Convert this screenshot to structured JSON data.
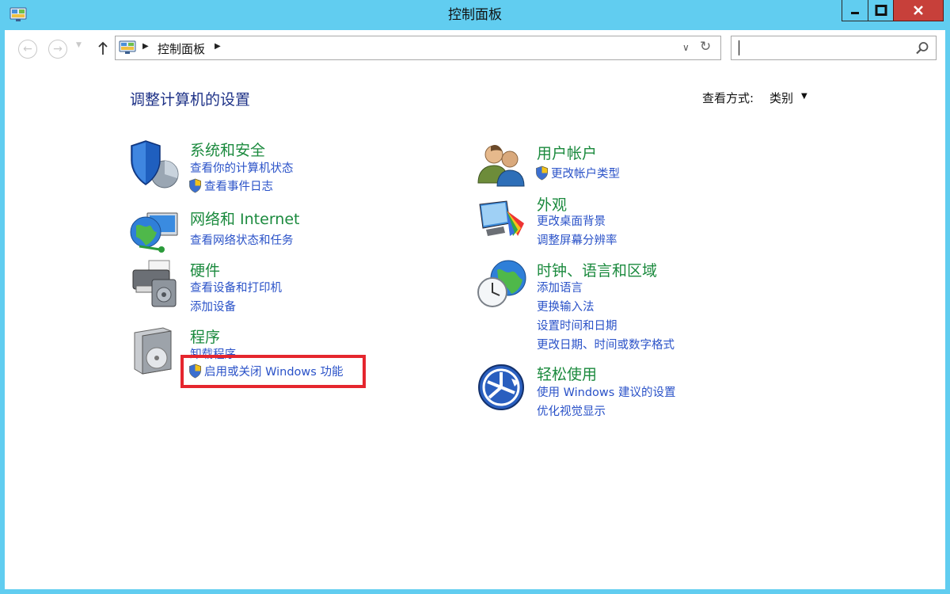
{
  "window": {
    "title": "控制面板"
  },
  "navigation": {
    "back_icon": "back-arrow-icon",
    "forward_icon": "forward-arrow-icon",
    "up_icon": "up-arrow-icon",
    "address_path": "控制面板",
    "search_value": "",
    "search_placeholder": ""
  },
  "main": {
    "heading": "调整计算机的设置",
    "view_by_label": "查看方式:",
    "view_by_value": "类别"
  },
  "categories_left": [
    {
      "id": "system-security",
      "title": "系统和安全",
      "links": [
        {
          "label": "查看你的计算机状态",
          "shield": false
        },
        {
          "label": "查看事件日志",
          "shield": true
        }
      ]
    },
    {
      "id": "network",
      "title": "网络和 Internet",
      "links": [
        {
          "label": "查看网络状态和任务",
          "shield": false
        }
      ]
    },
    {
      "id": "hardware",
      "title": "硬件",
      "links": [
        {
          "label": "查看设备和打印机",
          "shield": false
        },
        {
          "label": "添加设备",
          "shield": false
        }
      ]
    },
    {
      "id": "programs",
      "title": "程序",
      "links": [
        {
          "label": "卸载程序",
          "shield": false
        },
        {
          "label": "启用或关闭 Windows 功能",
          "shield": true
        }
      ]
    }
  ],
  "categories_right": [
    {
      "id": "user-accounts",
      "title": "用户帐户",
      "links": [
        {
          "label": "更改帐户类型",
          "shield": true
        }
      ]
    },
    {
      "id": "appearance",
      "title": "外观",
      "links": [
        {
          "label": "更改桌面背景",
          "shield": false
        },
        {
          "label": "调整屏幕分辨率",
          "shield": false
        }
      ]
    },
    {
      "id": "clock-region",
      "title": "时钟、语言和区域",
      "links": [
        {
          "label": "添加语言",
          "shield": false
        },
        {
          "label": "更换输入法",
          "shield": false
        },
        {
          "label": "设置时间和日期",
          "shield": false
        },
        {
          "label": "更改日期、时间或数字格式",
          "shield": false
        }
      ]
    },
    {
      "id": "ease-of-access",
      "title": "轻松使用",
      "links": [
        {
          "label": "使用 Windows 建议的设置",
          "shield": false
        },
        {
          "label": "优化视觉显示",
          "shield": false
        }
      ]
    }
  ],
  "colors": {
    "window_frame": "#61cdf0",
    "category_title": "#1b8a3e",
    "link": "#2a52c8",
    "heading": "#1e3287",
    "highlight": "#e5262e",
    "close_button": "#c7403a"
  }
}
